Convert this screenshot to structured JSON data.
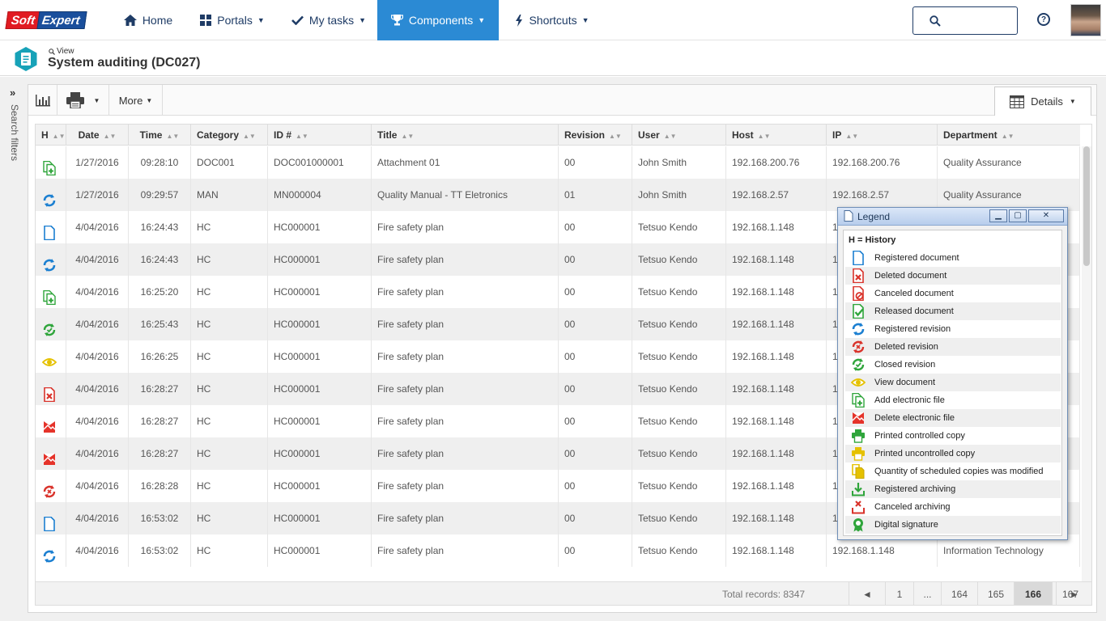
{
  "app": {
    "logo_left": "Soft",
    "logo_right": "Expert",
    "nav": [
      {
        "label": "Home",
        "icon": "home-icon"
      },
      {
        "label": "Portals",
        "icon": "grid-icon"
      },
      {
        "label": "My tasks",
        "icon": "check-icon"
      },
      {
        "label": "Components",
        "icon": "trophy-icon"
      },
      {
        "label": "Shortcuts",
        "icon": "bolt-icon"
      }
    ],
    "active_nav": "Components",
    "search_placeholder": "",
    "help_label": "?",
    "colors": {
      "nav_text": "#1f3c66",
      "active_bg": "#2b8ad4",
      "accent_teal": "#17a2b8"
    }
  },
  "page": {
    "view_label": "View",
    "title": "System auditing (DC027)"
  },
  "sidebar": {
    "toggle": "»",
    "label": "Search filters"
  },
  "toolbar": {
    "more_label": "More",
    "details_label": "Details"
  },
  "grid": {
    "columns": [
      "H",
      "Date",
      "Time",
      "Category",
      "ID #",
      "Title",
      "Revision",
      "User",
      "Host",
      "IP",
      "Department"
    ],
    "rows": [
      {
        "icon": "add-file",
        "date": "1/27/2016",
        "time": "09:28:10",
        "category": "DOC001",
        "id": "DOC001000001",
        "title": "Attachment 01",
        "revision": "00",
        "user": "John Smith",
        "host": "192.168.200.76",
        "ip": "192.168.200.76",
        "department": "Quality Assurance"
      },
      {
        "icon": "reg-revision",
        "date": "1/27/2016",
        "time": "09:29:57",
        "category": "MAN",
        "id": "MN000004",
        "title": "Quality Manual - TT Eletronics",
        "revision": "01",
        "user": "John Smith",
        "host": "192.168.2.57",
        "ip": "192.168.2.57",
        "department": "Quality Assurance"
      },
      {
        "icon": "reg-doc",
        "date": "4/04/2016",
        "time": "16:24:43",
        "category": "HC",
        "id": "HC000001",
        "title": "Fire safety plan",
        "revision": "00",
        "user": "Tetsuo Kendo",
        "host": "192.168.1.148",
        "ip": "1",
        "department": ""
      },
      {
        "icon": "reg-revision",
        "date": "4/04/2016",
        "time": "16:24:43",
        "category": "HC",
        "id": "HC000001",
        "title": "Fire safety plan",
        "revision": "00",
        "user": "Tetsuo Kendo",
        "host": "192.168.1.148",
        "ip": "1",
        "department": ""
      },
      {
        "icon": "add-file",
        "date": "4/04/2016",
        "time": "16:25:20",
        "category": "HC",
        "id": "HC000001",
        "title": "Fire safety plan",
        "revision": "00",
        "user": "Tetsuo Kendo",
        "host": "192.168.1.148",
        "ip": "1",
        "department": ""
      },
      {
        "icon": "closed-revision",
        "date": "4/04/2016",
        "time": "16:25:43",
        "category": "HC",
        "id": "HC000001",
        "title": "Fire safety plan",
        "revision": "00",
        "user": "Tetsuo Kendo",
        "host": "192.168.1.148",
        "ip": "1",
        "department": ""
      },
      {
        "icon": "view-doc",
        "date": "4/04/2016",
        "time": "16:26:25",
        "category": "HC",
        "id": "HC000001",
        "title": "Fire safety plan",
        "revision": "00",
        "user": "Tetsuo Kendo",
        "host": "192.168.1.148",
        "ip": "1",
        "department": ""
      },
      {
        "icon": "del-doc",
        "date": "4/04/2016",
        "time": "16:28:27",
        "category": "HC",
        "id": "HC000001",
        "title": "Fire safety plan",
        "revision": "00",
        "user": "Tetsuo Kendo",
        "host": "192.168.1.148",
        "ip": "1",
        "department": ""
      },
      {
        "icon": "del-file",
        "date": "4/04/2016",
        "time": "16:28:27",
        "category": "HC",
        "id": "HC000001",
        "title": "Fire safety plan",
        "revision": "00",
        "user": "Tetsuo Kendo",
        "host": "192.168.1.148",
        "ip": "1",
        "department": ""
      },
      {
        "icon": "del-file",
        "date": "4/04/2016",
        "time": "16:28:27",
        "category": "HC",
        "id": "HC000001",
        "title": "Fire safety plan",
        "revision": "00",
        "user": "Tetsuo Kendo",
        "host": "192.168.1.148",
        "ip": "1",
        "department": ""
      },
      {
        "icon": "del-revision",
        "date": "4/04/2016",
        "time": "16:28:28",
        "category": "HC",
        "id": "HC000001",
        "title": "Fire safety plan",
        "revision": "00",
        "user": "Tetsuo Kendo",
        "host": "192.168.1.148",
        "ip": "1",
        "department": ""
      },
      {
        "icon": "reg-doc",
        "date": "4/04/2016",
        "time": "16:53:02",
        "category": "HC",
        "id": "HC000001",
        "title": "Fire safety plan",
        "revision": "00",
        "user": "Tetsuo Kendo",
        "host": "192.168.1.148",
        "ip": "1",
        "department": ""
      },
      {
        "icon": "reg-revision",
        "date": "4/04/2016",
        "time": "16:53:02",
        "category": "HC",
        "id": "HC000001",
        "title": "Fire safety plan",
        "revision": "00",
        "user": "Tetsuo Kendo",
        "host": "192.168.1.148",
        "ip": "192.168.1.148",
        "department": "Information Technology"
      }
    ],
    "total_records": "Total records: 8347",
    "pages": [
      "◄",
      "1",
      "...",
      "164",
      "165",
      "166",
      "167",
      "►"
    ],
    "current_page": "166"
  },
  "legend": {
    "title": "Legend",
    "header": "H = History",
    "items": [
      {
        "icon": "reg-doc",
        "label": "Registered document"
      },
      {
        "icon": "del-doc",
        "label": "Deleted document"
      },
      {
        "icon": "cancel-doc",
        "label": "Canceled document"
      },
      {
        "icon": "released-doc",
        "label": "Released document"
      },
      {
        "icon": "reg-revision",
        "label": "Registered revision"
      },
      {
        "icon": "del-revision",
        "label": "Deleted revision"
      },
      {
        "icon": "closed-revision",
        "label": "Closed revision"
      },
      {
        "icon": "view-doc",
        "label": "View document"
      },
      {
        "icon": "add-file",
        "label": "Add electronic file"
      },
      {
        "icon": "del-file",
        "label": "Delete electronic file"
      },
      {
        "icon": "print-controlled",
        "label": "Printed controlled copy"
      },
      {
        "icon": "print-uncontrolled",
        "label": "Printed uncontrolled copy"
      },
      {
        "icon": "copies-modified",
        "label": "Quantity of scheduled copies was modified"
      },
      {
        "icon": "reg-archiving",
        "label": "Registered archiving"
      },
      {
        "icon": "cancel-archiving",
        "label": "Canceled archiving"
      },
      {
        "icon": "digital-signature",
        "label": "Digital signature"
      }
    ]
  }
}
